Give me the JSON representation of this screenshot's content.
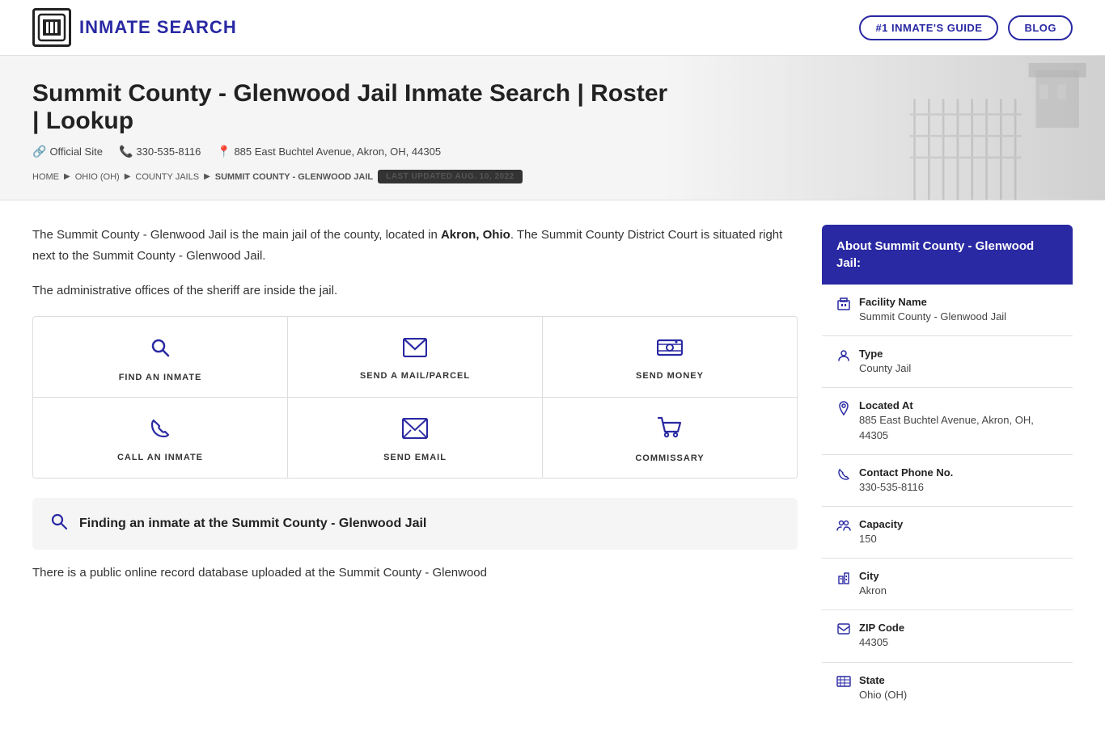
{
  "header": {
    "logo_text": "INMATE SEARCH",
    "nav_items": [
      {
        "label": "#1 INMATE'S GUIDE",
        "key": "inmates-guide"
      },
      {
        "label": "BLOG",
        "key": "blog"
      }
    ]
  },
  "hero": {
    "title": "Summit County - Glenwood Jail Inmate Search | Roster | Lookup",
    "official_site_label": "Official Site",
    "phone": "330-535-8116",
    "address": "885 East Buchtel Avenue, Akron, OH, 44305",
    "breadcrumb": [
      {
        "label": "HOME",
        "key": "home"
      },
      {
        "label": "OHIO (OH)",
        "key": "ohio"
      },
      {
        "label": "COUNTY JAILS",
        "key": "county-jails"
      },
      {
        "label": "SUMMIT COUNTY - GLENWOOD JAIL",
        "key": "summit"
      }
    ],
    "last_updated": "LAST UPDATED AUG. 10, 2022"
  },
  "main": {
    "description_1": "The Summit County - Glenwood Jail is the main jail of the county, located in ",
    "description_bold": "Akron, Ohio",
    "description_2": ". The Summit County District Court is situated right next to the Summit County - Glenwood Jail.",
    "description_3": "The administrative offices of the sheriff are inside the jail.",
    "actions": [
      [
        {
          "label": "FIND AN INMATE",
          "icon": "search",
          "key": "find-inmate"
        },
        {
          "label": "SEND A MAIL/PARCEL",
          "icon": "mail",
          "key": "send-mail"
        },
        {
          "label": "SEND MONEY",
          "icon": "money",
          "key": "send-money"
        }
      ],
      [
        {
          "label": "CALL AN INMATE",
          "icon": "phone",
          "key": "call-inmate"
        },
        {
          "label": "SEND EMAIL",
          "icon": "email",
          "key": "send-email"
        },
        {
          "label": "COMMISSARY",
          "icon": "cart",
          "key": "commissary"
        }
      ]
    ],
    "find_section": {
      "title": "Finding an inmate at the Summit County - Glenwood Jail"
    },
    "public_record_text": "There is a public online record database uploaded at the Summit County - Glenwood"
  },
  "sidebar": {
    "header": "About Summit County - Glenwood Jail:",
    "items": [
      {
        "label": "Facility Name",
        "value": "Summit County - Glenwood Jail",
        "icon": "building",
        "key": "facility-name"
      },
      {
        "label": "Type",
        "value": "County Jail",
        "icon": "person",
        "key": "type"
      },
      {
        "label": "Located At",
        "value": "885 East Buchtel Avenue, Akron, OH, 44305",
        "icon": "location",
        "key": "located-at"
      },
      {
        "label": "Contact Phone No.",
        "value": "330-535-8116",
        "icon": "phone",
        "key": "phone"
      },
      {
        "label": "Capacity",
        "value": "150",
        "icon": "people",
        "key": "capacity"
      },
      {
        "label": "City",
        "value": "Akron",
        "icon": "buildings",
        "key": "city"
      },
      {
        "label": "ZIP Code",
        "value": "44305",
        "icon": "mail",
        "key": "zip"
      },
      {
        "label": "State",
        "value": "Ohio (OH)",
        "icon": "map",
        "key": "state"
      }
    ]
  }
}
